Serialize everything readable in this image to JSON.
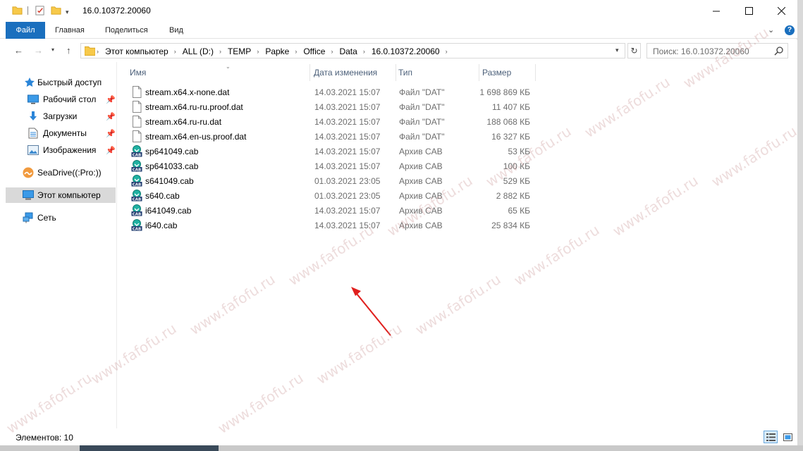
{
  "title": "16.0.10372.20060",
  "ribbon": {
    "tabs": [
      "Файл",
      "Главная",
      "Поделиться",
      "Вид"
    ]
  },
  "address": {
    "crumbs": [
      "Этот компьютер",
      "ALL (D:)",
      "TEMP",
      "Papke",
      "Office",
      "Data",
      "16.0.10372.20060"
    ]
  },
  "search": {
    "placeholder": "Поиск: 16.0.10372.20060"
  },
  "sidebar": {
    "items": [
      {
        "label": "Быстрый доступ",
        "icon": "star-icon"
      },
      {
        "label": "Рабочий стол",
        "icon": "desktop-icon"
      },
      {
        "label": "Загрузки",
        "icon": "download-icon"
      },
      {
        "label": "Документы",
        "icon": "documents-icon"
      },
      {
        "label": "Изображения",
        "icon": "pictures-icon"
      },
      {
        "label": "SeaDrive((:Pro:))",
        "icon": "seadrive-icon"
      },
      {
        "label": "Этот компьютер",
        "icon": "computer-icon"
      },
      {
        "label": "Сеть",
        "icon": "network-icon"
      }
    ]
  },
  "columns": {
    "name": "Имя",
    "date": "Дата изменения",
    "type": "Тип",
    "size": "Размер"
  },
  "files": [
    {
      "name": "stream.x64.x-none.dat",
      "date": "14.03.2021 15:07",
      "type": "Файл \"DAT\"",
      "size": "1 698 869 КБ",
      "kind": "dat"
    },
    {
      "name": "stream.x64.ru-ru.proof.dat",
      "date": "14.03.2021 15:07",
      "type": "Файл \"DAT\"",
      "size": "11 407 КБ",
      "kind": "dat"
    },
    {
      "name": "stream.x64.ru-ru.dat",
      "date": "14.03.2021 15:07",
      "type": "Файл \"DAT\"",
      "size": "188 068 КБ",
      "kind": "dat"
    },
    {
      "name": "stream.x64.en-us.proof.dat",
      "date": "14.03.2021 15:07",
      "type": "Файл \"DAT\"",
      "size": "16 327 КБ",
      "kind": "dat"
    },
    {
      "name": "sp641049.cab",
      "date": "14.03.2021 15:07",
      "type": "Архив CAB",
      "size": "53 КБ",
      "kind": "cab"
    },
    {
      "name": "sp641033.cab",
      "date": "14.03.2021 15:07",
      "type": "Архив CAB",
      "size": "100 КБ",
      "kind": "cab"
    },
    {
      "name": "s641049.cab",
      "date": "01.03.2021 23:05",
      "type": "Архив CAB",
      "size": "529 КБ",
      "kind": "cab"
    },
    {
      "name": "s640.cab",
      "date": "01.03.2021 23:05",
      "type": "Архив CAB",
      "size": "2 882 КБ",
      "kind": "cab"
    },
    {
      "name": "i641049.cab",
      "date": "14.03.2021 15:07",
      "type": "Архив CAB",
      "size": "65 КБ",
      "kind": "cab"
    },
    {
      "name": "i640.cab",
      "date": "14.03.2021 15:07",
      "type": "Архив CAB",
      "size": "25 834 КБ",
      "kind": "cab"
    }
  ],
  "status": {
    "count_text": "Элементов: 10"
  },
  "watermark": "www.fafofu.ru",
  "colors": {
    "accent": "#1a6fbe",
    "selection": "#d9d9d9",
    "annotation_arrow": "#e0201e"
  }
}
